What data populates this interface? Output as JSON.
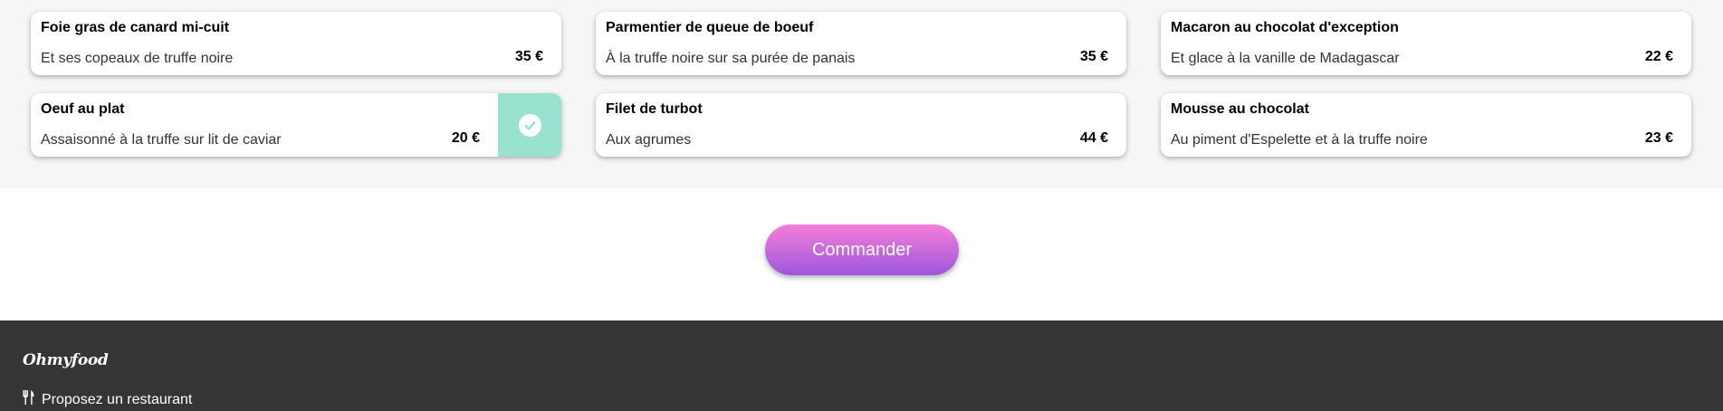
{
  "menu": {
    "dishes": [
      {
        "name": "Foie gras de canard mi-cuit",
        "description": "Et ses copeaux de truffe noire",
        "price": "35 €",
        "selected": false
      },
      {
        "name": "Parmentier de queue de boeuf",
        "description": "À la truffe noire sur sa purée de panais",
        "price": "35 €",
        "selected": false
      },
      {
        "name": "Macaron au chocolat d'exception",
        "description": "Et glace à la vanille de Madagascar",
        "price": "22 €",
        "selected": false
      },
      {
        "name": "Oeuf au plat",
        "description": "Assaisonné à la truffe sur lit de caviar",
        "price": "20 €",
        "selected": true
      },
      {
        "name": "Filet de turbot",
        "description": "Aux agrumes",
        "price": "44 €",
        "selected": false
      },
      {
        "name": "Mousse au chocolat",
        "description": "Au piment d'Espelette et à la truffe noire",
        "price": "23 €",
        "selected": false
      }
    ],
    "selected_icon": "check-icon",
    "selected_color": "#99e2d0"
  },
  "order": {
    "button_label": "Commander",
    "gradient": [
      "#f57ed8",
      "#9d56dc"
    ]
  },
  "footer": {
    "logo": "Ohmyfood",
    "link_label": "Proposez un restaurant",
    "link_icon": "utensils-icon",
    "background": "#353535"
  }
}
